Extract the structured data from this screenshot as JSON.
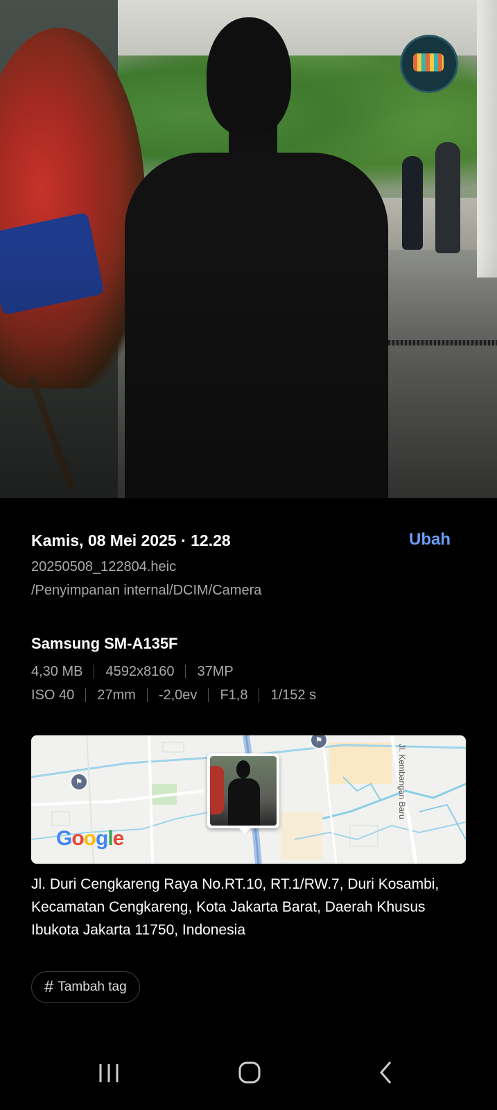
{
  "details": {
    "datetime": "Kamis, 08 Mei 2025 · 12.28",
    "edit_label": "Ubah",
    "filename": "20250508_122804.heic",
    "path": "/Penyimpanan internal/DCIM/Camera"
  },
  "camera": {
    "device": "Samsung SM-A135F",
    "file_size": "4,30 MB",
    "resolution": "4592x8160",
    "megapixels": "37MP",
    "iso": "ISO 40",
    "focal_length": "27mm",
    "exposure": "-2,0ev",
    "aperture": "F1,8",
    "shutter": "1/152 s"
  },
  "map": {
    "street_label": "Jl. Kembangan Baru",
    "logo": "Google"
  },
  "location": {
    "address": "Jl. Duri Cengkareng Raya No.RT.10, RT.1/RW.7, Duri Kosambi, Kecamatan Cengkareng, Kota Jakarta Barat, Daerah Khusus Ibukota Jakarta 11750, Indonesia"
  },
  "tags": {
    "hash": "#",
    "add_label": "Tambah tag"
  },
  "colors": {
    "accent": "#6b9df3",
    "background": "#000000",
    "secondary_text": "#a9a9a9"
  }
}
